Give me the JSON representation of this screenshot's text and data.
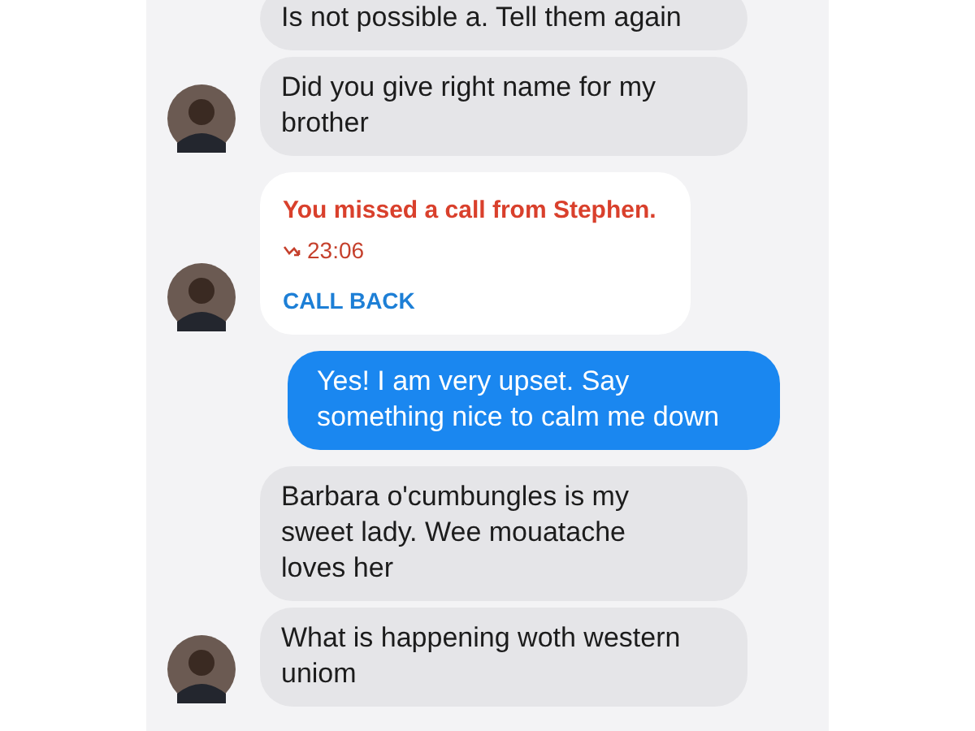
{
  "messages": [
    {
      "kind": "incoming",
      "texts": [
        "Is not possible a. Tell them again",
        "Did you give right name for my brother"
      ]
    },
    {
      "kind": "missed_call",
      "title": "You missed a call from Stephen.",
      "time": "23:06",
      "action": "CALL BACK"
    },
    {
      "kind": "outgoing",
      "texts": [
        "Yes! I am very upset. Say something nice to calm me down"
      ]
    },
    {
      "kind": "incoming",
      "texts": [
        "Barbara o'cumbungles is my sweet lady. Wee mouatache loves her",
        "What is happening woth western uniom"
      ]
    }
  ]
}
